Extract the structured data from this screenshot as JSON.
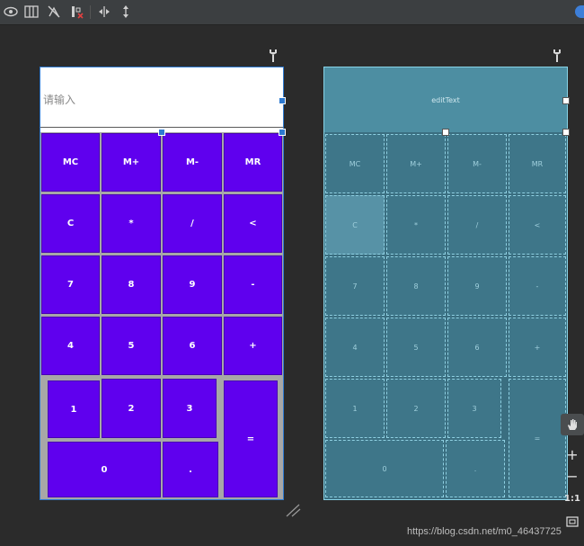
{
  "toolbar": {
    "icons": [
      "eye-icon",
      "blueprint-columns-icon",
      "show-constraints-off-icon",
      "error-bar-icon",
      "expand-horizontal-icon",
      "expand-vertical-icon"
    ]
  },
  "design": {
    "edit_placeholder": "请输入",
    "keys": [
      "MC",
      "M+",
      "M-",
      "MR",
      "C",
      "*",
      "/",
      "<",
      "7",
      "8",
      "9",
      "-",
      "4",
      "5",
      "6",
      "+",
      "1",
      "2",
      "3",
      "=",
      "0",
      "."
    ]
  },
  "blueprint": {
    "edit_label": "editText",
    "keys": [
      "MC",
      "M+",
      "M-",
      "MR",
      "C",
      "*",
      "/",
      "<",
      "7",
      "8",
      "9",
      "-",
      "4",
      "5",
      "6",
      "+",
      "1",
      "2",
      "3",
      "=",
      "0",
      "."
    ]
  },
  "zoom": {
    "plus": "+",
    "minus": "−",
    "one_to_one": "1:1"
  },
  "watermark": "https://blog.csdn.net/m0_46437725",
  "colors": {
    "button_purple": "#5f00ee",
    "blueprint_bg": "#3a6e80",
    "selection_blue": "#2e7ad1"
  }
}
